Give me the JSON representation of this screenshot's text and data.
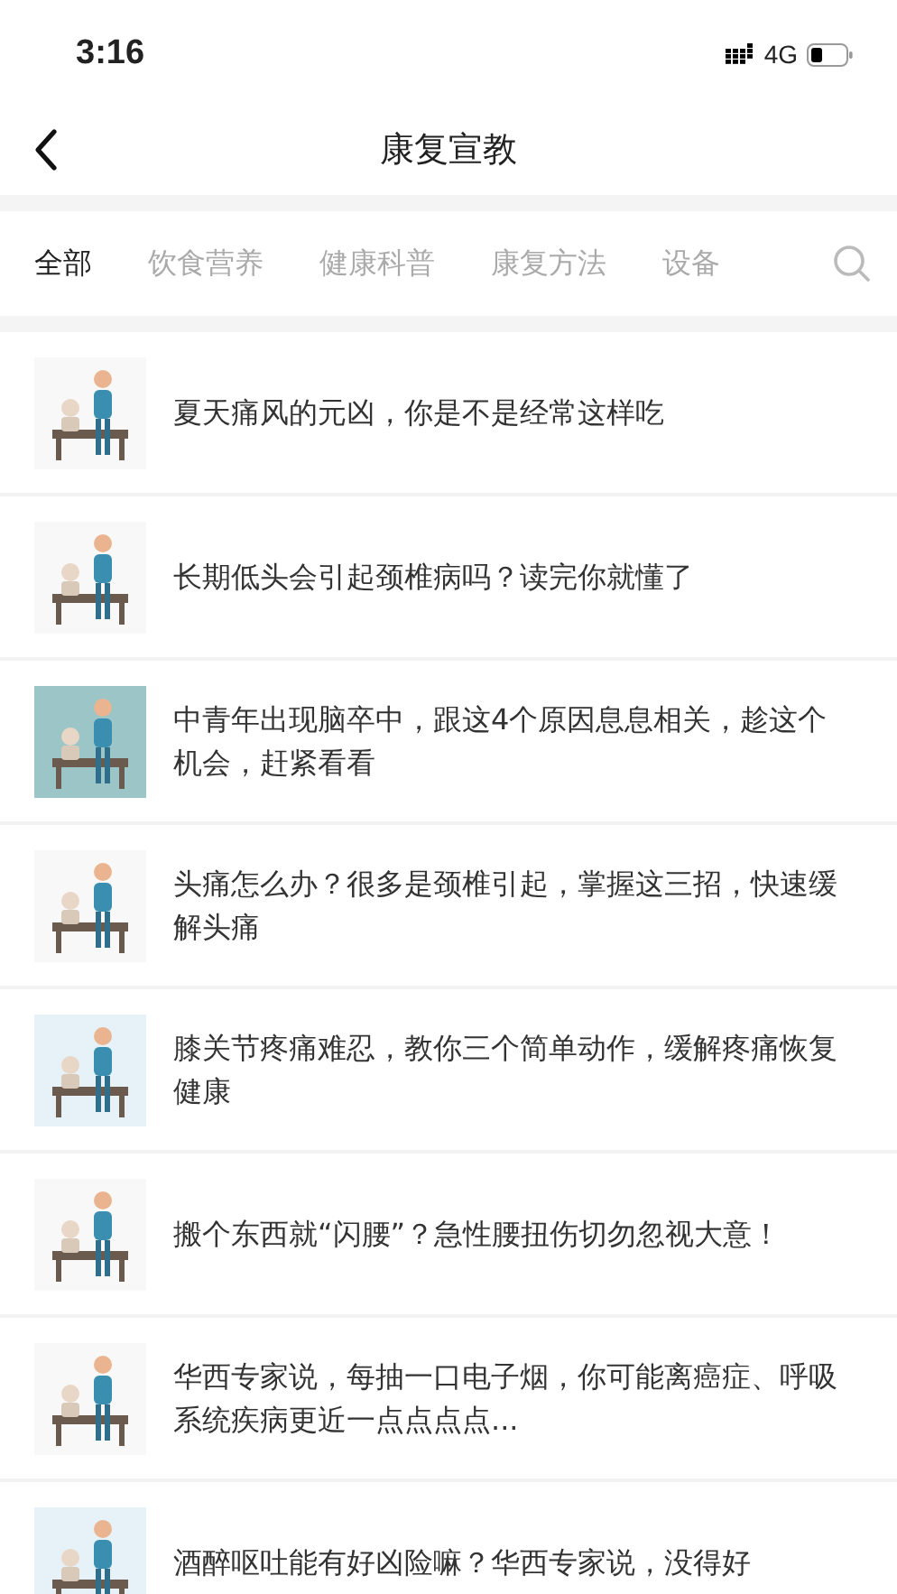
{
  "status_bar": {
    "time": "3:16",
    "network": "4G"
  },
  "header": {
    "title": "康复宣教"
  },
  "tabs": [
    {
      "label": "全部",
      "selected": true
    },
    {
      "label": "饮食营养",
      "selected": false
    },
    {
      "label": "健康科普",
      "selected": false
    },
    {
      "label": "康复方法",
      "selected": false
    },
    {
      "label": "设备",
      "selected": false
    }
  ],
  "articles": [
    {
      "title": "夏天痛风的元凶，你是不是经常这样吃",
      "color": "#f8f8f8"
    },
    {
      "title": "长期低头会引起颈椎病吗？读完你就懂了",
      "color": "#f8f8f8"
    },
    {
      "title": "中青年出现脑卒中，跟这4个原因息息相关，趁这个机会，赶紧看看",
      "color": "#9cc5c8"
    },
    {
      "title": "头痛怎么办？很多是颈椎引起，掌握这三招，快速缓解头痛",
      "color": "#f8f8f8"
    },
    {
      "title": "膝关节疼痛难忍，教你三个简单动作，缓解疼痛恢复健康",
      "color": "#e6f1f8"
    },
    {
      "title": "搬个东西就“闪腰”？急性腰扭伤切勿忽视大意！",
      "color": "#f8f8f8"
    },
    {
      "title": "华西专家说，每抽一口电子烟，你可能离癌症、呼吸系统疾病更近一点点点点...",
      "color": "#f8f8f8"
    },
    {
      "title": "酒醉呕吐能有好凶险嘛？华西专家说，没得好",
      "color": "#e6f1f8"
    }
  ]
}
